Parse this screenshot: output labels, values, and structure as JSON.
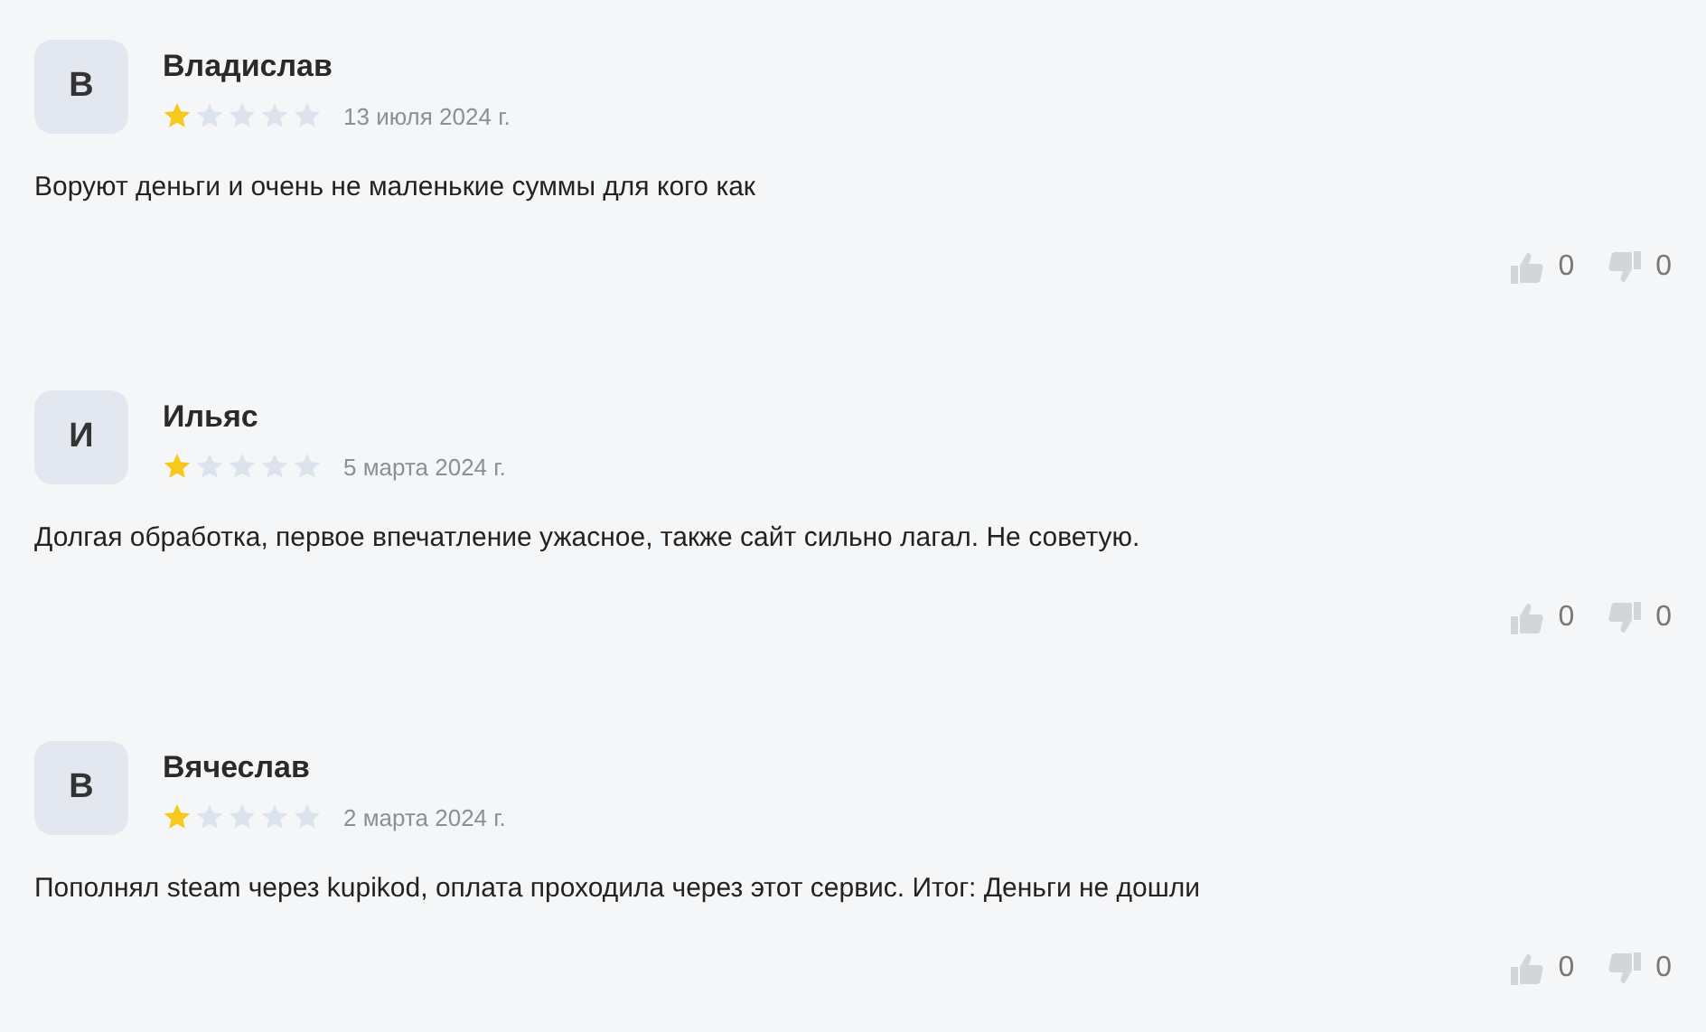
{
  "reviews": [
    {
      "initial": "В",
      "name": "Владислав",
      "stars": 1,
      "date": "13 июля 2024 г.",
      "text": "Воруют деньги и очень не маленькие суммы для кого как",
      "likes": "0",
      "dislikes": "0"
    },
    {
      "initial": "И",
      "name": "Ильяс",
      "stars": 1,
      "date": "5 марта 2024 г.",
      "text": "Долгая обработка, первое впечатление ужасное, также сайт сильно лагал. Не советую.",
      "likes": "0",
      "dislikes": "0"
    },
    {
      "initial": "В",
      "name": "Вячеслав",
      "stars": 1,
      "date": "2 марта 2024 г.",
      "text": "Пополнял steam через kupikod, оплата проходила через этот сервис. Итог: Деньги не дошли",
      "likes": "0",
      "dislikes": "0"
    }
  ]
}
